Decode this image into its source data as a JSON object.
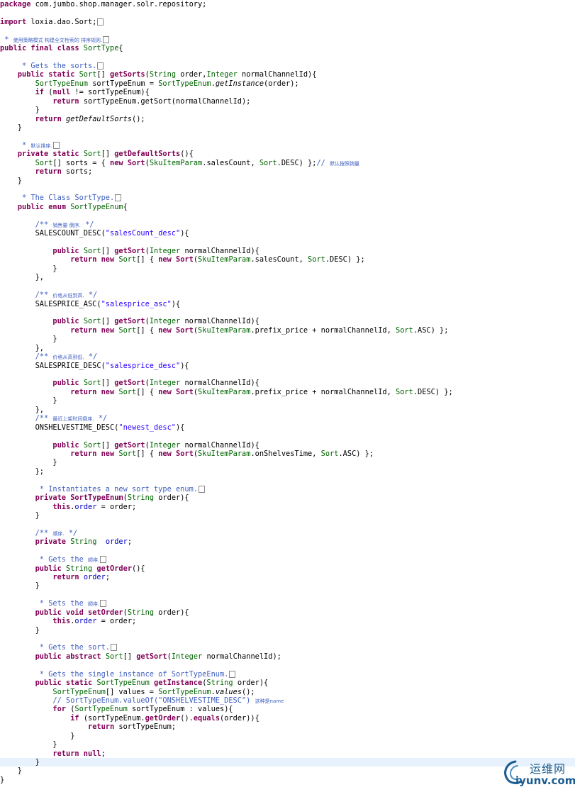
{
  "editor": {
    "highlighted_line": 86,
    "lines": [
      [
        {
          "t": "package ",
          "c": "kw"
        },
        {
          "t": "com.jumbo.shop.manager.solr.repository;"
        }
      ],
      [],
      [
        {
          "t": "import ",
          "c": "kw"
        },
        {
          "t": "loxia.dao.Sort;"
        },
        {
          "box": true
        }
      ],
      [],
      [
        {
          "t": " * ",
          "c": "cm"
        },
        {
          "t": "使用策略模式 构建全文检索的 排序规则.",
          "c": "cm cj"
        },
        {
          "box": true
        }
      ],
      [
        {
          "t": "public final class ",
          "c": "kw"
        },
        {
          "t": "SortType",
          "c": "ty"
        },
        {
          "t": "{"
        }
      ],
      [],
      [
        {
          "t": "     * Gets the sorts.",
          "c": "cm"
        },
        {
          "box": true
        }
      ],
      [
        {
          "t": "    "
        },
        {
          "t": "public static ",
          "c": "kw"
        },
        {
          "t": "Sort",
          "c": "ty"
        },
        {
          "t": "[] "
        },
        {
          "t": "getSorts",
          "c": "kw"
        },
        {
          "t": "("
        },
        {
          "t": "String",
          "c": "ty"
        },
        {
          "t": " order,"
        },
        {
          "t": "Integer",
          "c": "ty"
        },
        {
          "t": " normalChannelId){"
        }
      ],
      [
        {
          "t": "        "
        },
        {
          "t": "SortTypeEnum",
          "c": "ty"
        },
        {
          "t": " sortTypeEnum = "
        },
        {
          "t": "SortTypeEnum",
          "c": "ty"
        },
        {
          "t": "."
        },
        {
          "t": "getInstance",
          "c": "it"
        },
        {
          "t": "(order);"
        }
      ],
      [
        {
          "t": "        "
        },
        {
          "t": "if ",
          "c": "kw"
        },
        {
          "t": "("
        },
        {
          "t": "null",
          "c": "kw"
        },
        {
          "t": " != sortTypeEnum){"
        }
      ],
      [
        {
          "t": "            "
        },
        {
          "t": "return ",
          "c": "kw"
        },
        {
          "t": "sortTypeEnum.getSort(normalChannelId);"
        }
      ],
      [
        {
          "t": "        }"
        }
      ],
      [
        {
          "t": "        "
        },
        {
          "t": "return ",
          "c": "kw"
        },
        {
          "t": "getDefaultSorts",
          "c": "it"
        },
        {
          "t": "();"
        }
      ],
      [
        {
          "t": "    }"
        }
      ],
      [],
      [
        {
          "t": "     * ",
          "c": "cm"
        },
        {
          "t": "默认排序.",
          "c": "cm cj"
        },
        {
          "box": true
        }
      ],
      [
        {
          "t": "    "
        },
        {
          "t": "private static ",
          "c": "kw"
        },
        {
          "t": "Sort",
          "c": "ty"
        },
        {
          "t": "[] "
        },
        {
          "t": "getDefaultSorts",
          "c": "kw"
        },
        {
          "t": "(){"
        }
      ],
      [
        {
          "t": "        "
        },
        {
          "t": "Sort",
          "c": "ty"
        },
        {
          "t": "[] sorts = { "
        },
        {
          "t": "new ",
          "c": "kw"
        },
        {
          "t": "Sort",
          "c": "kw"
        },
        {
          "t": "("
        },
        {
          "t": "SkuItemParam",
          "c": "ty"
        },
        {
          "t": ".salesCount, "
        },
        {
          "t": "Sort",
          "c": "ty"
        },
        {
          "t": ".DESC) };"
        },
        {
          "t": "// ",
          "c": "cm"
        },
        {
          "t": "默认按照销量",
          "c": "cm cj"
        }
      ],
      [
        {
          "t": "        "
        },
        {
          "t": "return ",
          "c": "kw"
        },
        {
          "t": "sorts;"
        }
      ],
      [
        {
          "t": "    }"
        }
      ],
      [],
      [
        {
          "t": "     * The Class SortType.",
          "c": "cm"
        },
        {
          "box": true
        }
      ],
      [
        {
          "t": "    "
        },
        {
          "t": "public enum ",
          "c": "kw"
        },
        {
          "t": "SortTypeEnum",
          "c": "ty"
        },
        {
          "t": "{"
        }
      ],
      [],
      [
        {
          "t": "        "
        },
        {
          "t": "/** ",
          "c": "cm"
        },
        {
          "t": "销售量 倒序.",
          "c": "cm cj"
        },
        {
          "t": " */",
          "c": "cm"
        }
      ],
      [
        {
          "t": "        SALESCOUNT_DESC("
        },
        {
          "t": "\"salesCount_desc\"",
          "c": "st"
        },
        {
          "t": "){"
        }
      ],
      [],
      [
        {
          "t": "            "
        },
        {
          "t": "public ",
          "c": "kw"
        },
        {
          "t": "Sort",
          "c": "ty"
        },
        {
          "t": "[] "
        },
        {
          "t": "getSort",
          "c": "kw"
        },
        {
          "t": "("
        },
        {
          "t": "Integer",
          "c": "ty"
        },
        {
          "t": " normalChannelId){"
        }
      ],
      [
        {
          "t": "                "
        },
        {
          "t": "return new ",
          "c": "kw"
        },
        {
          "t": "Sort",
          "c": "ty"
        },
        {
          "t": "[] { "
        },
        {
          "t": "new ",
          "c": "kw"
        },
        {
          "t": "Sort",
          "c": "kw"
        },
        {
          "t": "("
        },
        {
          "t": "SkuItemParam",
          "c": "ty"
        },
        {
          "t": ".salesCount, "
        },
        {
          "t": "Sort",
          "c": "ty"
        },
        {
          "t": ".DESC) };"
        }
      ],
      [
        {
          "t": "            }"
        }
      ],
      [
        {
          "t": "        },"
        }
      ],
      [],
      [
        {
          "t": "        "
        },
        {
          "t": "/** ",
          "c": "cm"
        },
        {
          "t": "价格从低到高.",
          "c": "cm cj"
        },
        {
          "t": " */",
          "c": "cm"
        }
      ],
      [
        {
          "t": "        SALESPRICE_ASC("
        },
        {
          "t": "\"salesprice_asc\"",
          "c": "st"
        },
        {
          "t": "){"
        }
      ],
      [],
      [
        {
          "t": "            "
        },
        {
          "t": "public ",
          "c": "kw"
        },
        {
          "t": "Sort",
          "c": "ty"
        },
        {
          "t": "[] "
        },
        {
          "t": "getSort",
          "c": "kw"
        },
        {
          "t": "("
        },
        {
          "t": "Integer",
          "c": "ty"
        },
        {
          "t": " normalChannelId){"
        }
      ],
      [
        {
          "t": "                "
        },
        {
          "t": "return new ",
          "c": "kw"
        },
        {
          "t": "Sort",
          "c": "ty"
        },
        {
          "t": "[] { "
        },
        {
          "t": "new ",
          "c": "kw"
        },
        {
          "t": "Sort",
          "c": "kw"
        },
        {
          "t": "("
        },
        {
          "t": "SkuItemParam",
          "c": "ty"
        },
        {
          "t": ".prefix_price + normalChannelId, "
        },
        {
          "t": "Sort",
          "c": "ty"
        },
        {
          "t": ".ASC) };"
        }
      ],
      [
        {
          "t": "            }"
        }
      ],
      [
        {
          "t": "        },"
        }
      ],
      [
        {
          "t": "        "
        },
        {
          "t": "/** ",
          "c": "cm"
        },
        {
          "t": "价格从高到低.",
          "c": "cm cj"
        },
        {
          "t": " */",
          "c": "cm"
        }
      ],
      [
        {
          "t": "        SALESPRICE_DESC("
        },
        {
          "t": "\"salesprice_desc\"",
          "c": "st"
        },
        {
          "t": "){"
        }
      ],
      [],
      [
        {
          "t": "            "
        },
        {
          "t": "public ",
          "c": "kw"
        },
        {
          "t": "Sort",
          "c": "ty"
        },
        {
          "t": "[] "
        },
        {
          "t": "getSort",
          "c": "kw"
        },
        {
          "t": "("
        },
        {
          "t": "Integer",
          "c": "ty"
        },
        {
          "t": " normalChannelId){"
        }
      ],
      [
        {
          "t": "                "
        },
        {
          "t": "return new ",
          "c": "kw"
        },
        {
          "t": "Sort",
          "c": "ty"
        },
        {
          "t": "[] { "
        },
        {
          "t": "new ",
          "c": "kw"
        },
        {
          "t": "Sort",
          "c": "kw"
        },
        {
          "t": "("
        },
        {
          "t": "SkuItemParam",
          "c": "ty"
        },
        {
          "t": ".prefix_price + normalChannelId, "
        },
        {
          "t": "Sort",
          "c": "ty"
        },
        {
          "t": ".DESC) };"
        }
      ],
      [
        {
          "t": "            }"
        }
      ],
      [
        {
          "t": "        },"
        }
      ],
      [
        {
          "t": "        "
        },
        {
          "t": "/** ",
          "c": "cm"
        },
        {
          "t": "最近上架时间倒序.",
          "c": "cm cj"
        },
        {
          "t": " */",
          "c": "cm"
        }
      ],
      [
        {
          "t": "        ONSHELVESTIME_DESC("
        },
        {
          "t": "\"newest_desc\"",
          "c": "st"
        },
        {
          "t": "){"
        }
      ],
      [],
      [
        {
          "t": "            "
        },
        {
          "t": "public ",
          "c": "kw"
        },
        {
          "t": "Sort",
          "c": "ty"
        },
        {
          "t": "[] "
        },
        {
          "t": "getSort",
          "c": "kw"
        },
        {
          "t": "("
        },
        {
          "t": "Integer",
          "c": "ty"
        },
        {
          "t": " normalChannelId){"
        }
      ],
      [
        {
          "t": "                "
        },
        {
          "t": "return new ",
          "c": "kw"
        },
        {
          "t": "Sort",
          "c": "ty"
        },
        {
          "t": "[] { "
        },
        {
          "t": "new ",
          "c": "kw"
        },
        {
          "t": "Sort",
          "c": "kw"
        },
        {
          "t": "("
        },
        {
          "t": "SkuItemParam",
          "c": "ty"
        },
        {
          "t": ".onShelvesTime, "
        },
        {
          "t": "Sort",
          "c": "ty"
        },
        {
          "t": ".ASC) };"
        }
      ],
      [
        {
          "t": "            }"
        }
      ],
      [
        {
          "t": "        };"
        }
      ],
      [],
      [
        {
          "t": "         * Instantiates a new sort type enum.",
          "c": "cm"
        },
        {
          "box": true
        }
      ],
      [
        {
          "t": "        "
        },
        {
          "t": "private ",
          "c": "kw"
        },
        {
          "t": "SortTypeEnum",
          "c": "kw"
        },
        {
          "t": "("
        },
        {
          "t": "String",
          "c": "ty"
        },
        {
          "t": " order){"
        }
      ],
      [
        {
          "t": "            "
        },
        {
          "t": "this",
          "c": "kw"
        },
        {
          "t": "."
        },
        {
          "t": "order",
          "c": "fd"
        },
        {
          "t": " = order;"
        }
      ],
      [
        {
          "t": "        }"
        }
      ],
      [],
      [
        {
          "t": "        "
        },
        {
          "t": "/** ",
          "c": "cm"
        },
        {
          "t": "顺序.",
          "c": "cm cj"
        },
        {
          "t": " */",
          "c": "cm"
        }
      ],
      [
        {
          "t": "        "
        },
        {
          "t": "private ",
          "c": "kw"
        },
        {
          "t": "String",
          "c": "ty"
        },
        {
          "t": "  "
        },
        {
          "t": "order",
          "c": "fd"
        },
        {
          "t": ";"
        }
      ],
      [],
      [
        {
          "t": "         * Gets the ",
          "c": "cm"
        },
        {
          "t": "顺序.",
          "c": "cm cj"
        },
        {
          "box": true
        }
      ],
      [
        {
          "t": "        "
        },
        {
          "t": "public ",
          "c": "kw"
        },
        {
          "t": "String",
          "c": "ty"
        },
        {
          "t": " "
        },
        {
          "t": "getOrder",
          "c": "kw"
        },
        {
          "t": "(){"
        }
      ],
      [
        {
          "t": "            "
        },
        {
          "t": "return ",
          "c": "kw"
        },
        {
          "t": "order",
          "c": "fd"
        },
        {
          "t": ";"
        }
      ],
      [
        {
          "t": "        }"
        }
      ],
      [],
      [
        {
          "t": "         * Sets the ",
          "c": "cm"
        },
        {
          "t": "顺序.",
          "c": "cm cj"
        },
        {
          "box": true
        }
      ],
      [
        {
          "t": "        "
        },
        {
          "t": "public void ",
          "c": "kw"
        },
        {
          "t": "setOrder",
          "c": "kw"
        },
        {
          "t": "("
        },
        {
          "t": "String",
          "c": "ty"
        },
        {
          "t": " order){"
        }
      ],
      [
        {
          "t": "            "
        },
        {
          "t": "this",
          "c": "kw"
        },
        {
          "t": "."
        },
        {
          "t": "order",
          "c": "fd"
        },
        {
          "t": " = order;"
        }
      ],
      [
        {
          "t": "        }"
        }
      ],
      [],
      [
        {
          "t": "         * Gets the sort.",
          "c": "cm"
        },
        {
          "box": true
        }
      ],
      [
        {
          "t": "        "
        },
        {
          "t": "public abstract ",
          "c": "kw"
        },
        {
          "t": "Sort",
          "c": "ty"
        },
        {
          "t": "[] "
        },
        {
          "t": "getSort",
          "c": "kw"
        },
        {
          "t": "("
        },
        {
          "t": "Integer",
          "c": "ty"
        },
        {
          "t": " normalChannelId);"
        }
      ],
      [],
      [
        {
          "t": "         * Gets the single instance of SortTypeEnum.",
          "c": "cm"
        },
        {
          "box": true
        }
      ],
      [
        {
          "t": "        "
        },
        {
          "t": "public static ",
          "c": "kw"
        },
        {
          "t": "SortTypeEnum",
          "c": "ty"
        },
        {
          "t": " "
        },
        {
          "t": "getInstance",
          "c": "kw"
        },
        {
          "t": "("
        },
        {
          "t": "String",
          "c": "ty"
        },
        {
          "t": " order){"
        }
      ],
      [
        {
          "t": "            "
        },
        {
          "t": "SortTypeEnum",
          "c": "ty"
        },
        {
          "t": "[] values = "
        },
        {
          "t": "SortTypeEnum",
          "c": "ty"
        },
        {
          "t": "."
        },
        {
          "t": "values",
          "c": "it"
        },
        {
          "t": "();"
        }
      ],
      [
        {
          "t": "            // SortTypeEnum.valueOf(\"ONSHELVESTIME_DESC\") ",
          "c": "cm"
        },
        {
          "t": "这种是name",
          "c": "cm cj"
        }
      ],
      [
        {
          "t": "            "
        },
        {
          "t": "for ",
          "c": "kw"
        },
        {
          "t": "("
        },
        {
          "t": "SortTypeEnum",
          "c": "ty"
        },
        {
          "t": " sortTypeEnum : values){"
        }
      ],
      [
        {
          "t": "                "
        },
        {
          "t": "if ",
          "c": "kw"
        },
        {
          "t": "(sortTypeEnum."
        },
        {
          "t": "getOrder",
          "c": "kw"
        },
        {
          "t": "()."
        },
        {
          "t": "equals",
          "c": "kw"
        },
        {
          "t": "(order)){"
        }
      ],
      [
        {
          "t": "                    "
        },
        {
          "t": "return ",
          "c": "kw"
        },
        {
          "t": "sortTypeEnum;"
        }
      ],
      [
        {
          "t": "                }"
        }
      ],
      [
        {
          "t": "            }"
        }
      ],
      [
        {
          "t": "            "
        },
        {
          "t": "return null",
          "c": "kw"
        },
        {
          "t": ";"
        }
      ],
      [
        {
          "t": "        }"
        }
      ],
      [
        {
          "t": "    }"
        }
      ],
      [
        {
          "t": "}"
        }
      ]
    ]
  },
  "watermark": {
    "cn_text": "运维网",
    "domain_text": "iyunv.com",
    "color": "#1c5d8f"
  }
}
